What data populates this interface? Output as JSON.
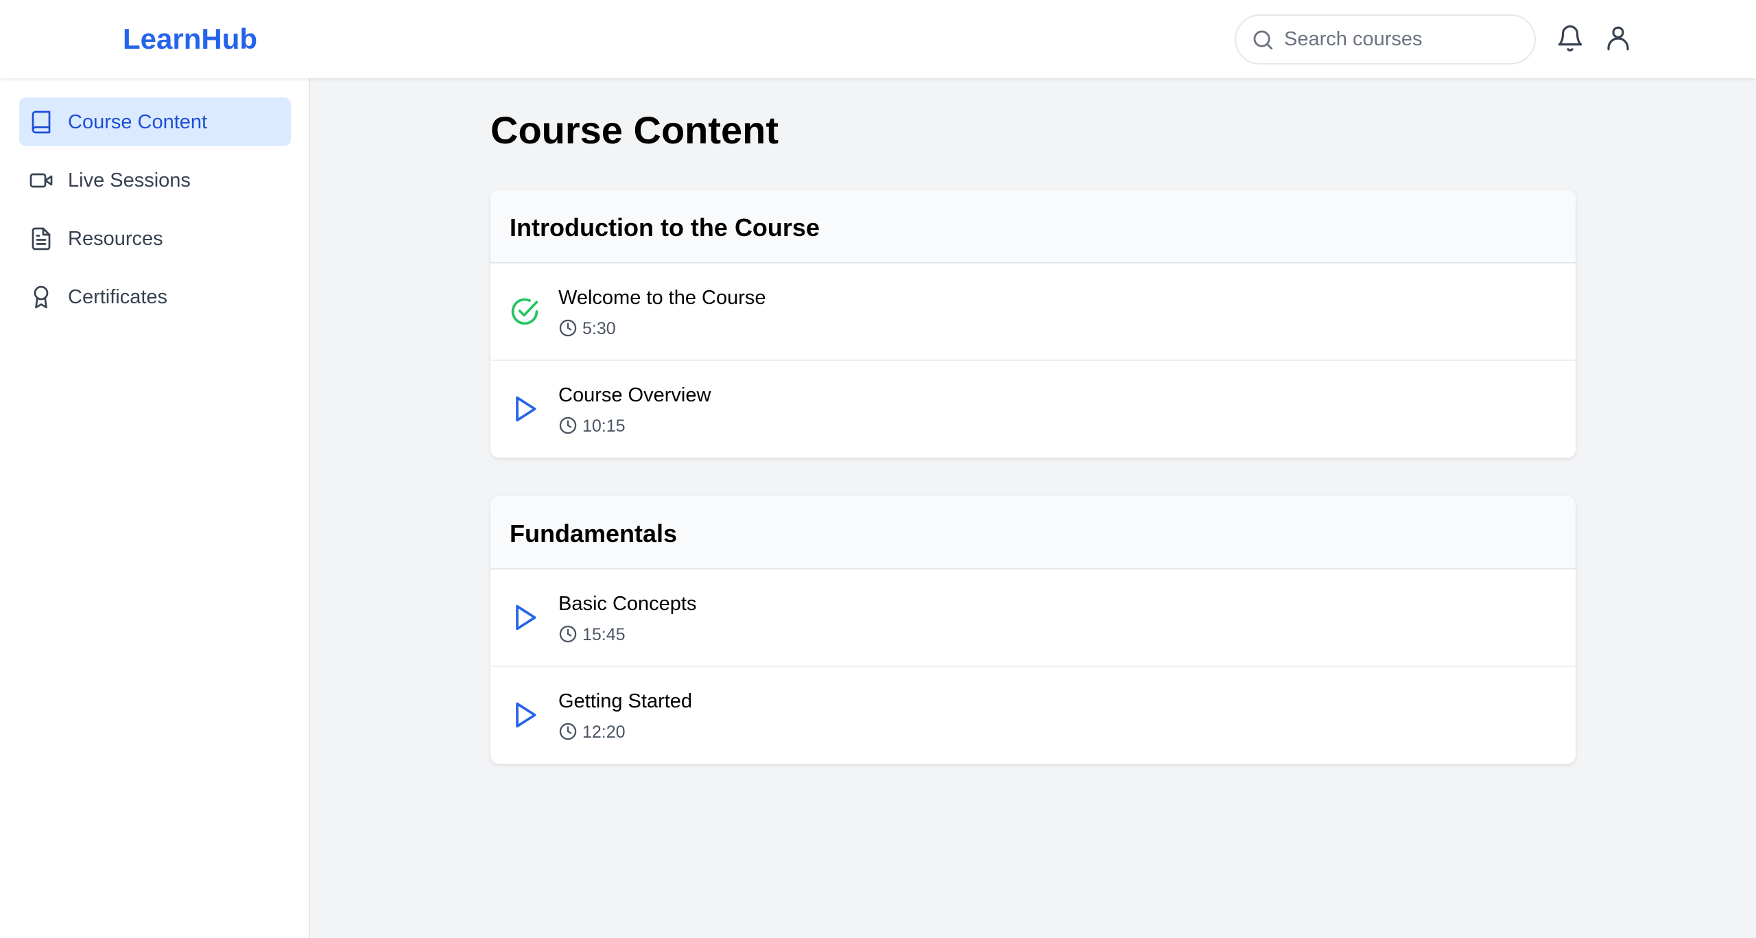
{
  "header": {
    "logo": "LearnHub",
    "search": {
      "placeholder": "Search courses",
      "value": ""
    },
    "icons": [
      "search-icon",
      "bell-icon",
      "user-icon"
    ]
  },
  "sidebar": {
    "items": [
      {
        "label": "Course Content",
        "icon": "book-icon",
        "active": true
      },
      {
        "label": "Live Sessions",
        "icon": "video-icon",
        "active": false
      },
      {
        "label": "Resources",
        "icon": "document-icon",
        "active": false
      },
      {
        "label": "Certificates",
        "icon": "award-icon",
        "active": false
      }
    ]
  },
  "main": {
    "title": "Course Content",
    "modules": [
      {
        "title": "Introduction to the Course",
        "lessons": [
          {
            "title": "Welcome to the Course",
            "duration": "5:30",
            "status": "completed",
            "icon": "check-circle-icon"
          },
          {
            "title": "Course Overview",
            "duration": "10:15",
            "status": "not-started",
            "icon": "play-icon"
          }
        ]
      },
      {
        "title": "Fundamentals",
        "lessons": [
          {
            "title": "Basic Concepts",
            "duration": "15:45",
            "status": "not-started",
            "icon": "play-icon"
          },
          {
            "title": "Getting Started",
            "duration": "12:20",
            "status": "not-started",
            "icon": "play-icon"
          }
        ]
      }
    ]
  },
  "colors": {
    "accent": "#2563eb",
    "active_nav_bg": "#dbeafe",
    "completed": "#22c55e",
    "page_bg": "#f3f4f6"
  }
}
